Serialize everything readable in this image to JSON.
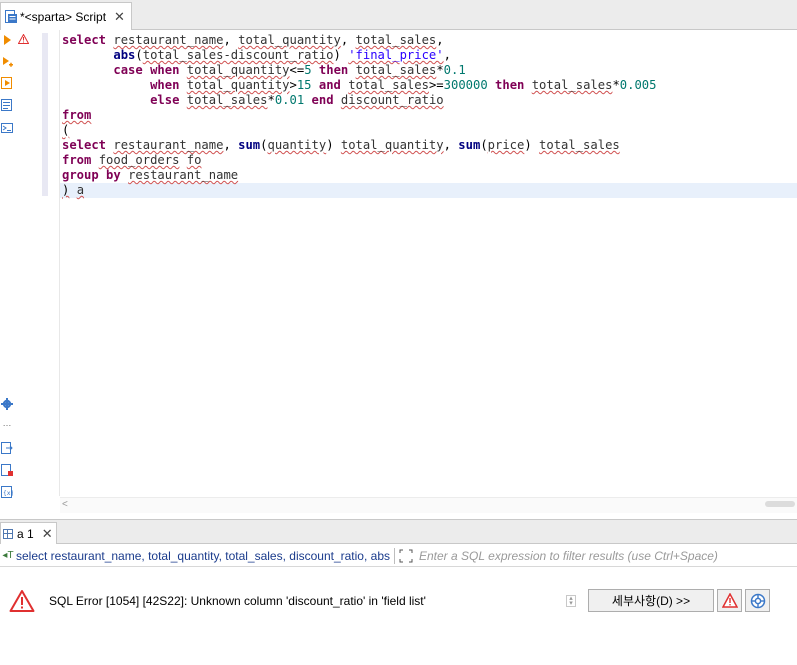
{
  "editor_tab": {
    "label": "*<sparta> Script",
    "close": "✕"
  },
  "code_lines": [
    [
      {
        "t": "select",
        "c": "kw"
      },
      {
        "t": " "
      },
      {
        "t": "restaurant_name",
        "c": "id sq"
      },
      {
        "t": ", "
      },
      {
        "t": "total_quantity",
        "c": "id sq"
      },
      {
        "t": ", "
      },
      {
        "t": "total_sales",
        "c": "id sq"
      },
      {
        "t": ","
      }
    ],
    [
      {
        "t": "       "
      },
      {
        "t": "abs",
        "c": "fn"
      },
      {
        "t": "("
      },
      {
        "t": "total_sales-discount_ratio",
        "c": "id sq"
      },
      {
        "t": ") "
      },
      {
        "t": "'final_price'",
        "c": "str sq"
      },
      {
        "t": ","
      }
    ],
    [
      {
        "t": "       "
      },
      {
        "t": "case",
        "c": "kw"
      },
      {
        "t": " "
      },
      {
        "t": "when",
        "c": "kw"
      },
      {
        "t": " "
      },
      {
        "t": "total_quantity",
        "c": "id sq"
      },
      {
        "t": "<="
      },
      {
        "t": "5",
        "c": "num"
      },
      {
        "t": " "
      },
      {
        "t": "then",
        "c": "kw"
      },
      {
        "t": " "
      },
      {
        "t": "total_sales",
        "c": "id sq"
      },
      {
        "t": "*"
      },
      {
        "t": "0.1",
        "c": "num"
      }
    ],
    [
      {
        "t": "            "
      },
      {
        "t": "when",
        "c": "kw"
      },
      {
        "t": " "
      },
      {
        "t": "total_quantity",
        "c": "id sq"
      },
      {
        "t": ">"
      },
      {
        "t": "15",
        "c": "num"
      },
      {
        "t": " "
      },
      {
        "t": "and",
        "c": "kw"
      },
      {
        "t": " "
      },
      {
        "t": "total_sales",
        "c": "id sq"
      },
      {
        "t": ">="
      },
      {
        "t": "300000",
        "c": "num"
      },
      {
        "t": " "
      },
      {
        "t": "then",
        "c": "kw"
      },
      {
        "t": " "
      },
      {
        "t": "total_sales",
        "c": "id sq"
      },
      {
        "t": "*"
      },
      {
        "t": "0.005",
        "c": "num"
      }
    ],
    [
      {
        "t": "            "
      },
      {
        "t": "else",
        "c": "kw"
      },
      {
        "t": " "
      },
      {
        "t": "total_sales",
        "c": "id sq"
      },
      {
        "t": "*"
      },
      {
        "t": "0.01",
        "c": "num"
      },
      {
        "t": " "
      },
      {
        "t": "end",
        "c": "kw"
      },
      {
        "t": " "
      },
      {
        "t": "discount_ratio",
        "c": "id sq"
      }
    ],
    [
      {
        "t": "from",
        "c": "kw sq"
      }
    ],
    [
      {
        "t": "(",
        "c": "sq"
      }
    ],
    [
      {
        "t": "select",
        "c": "kw"
      },
      {
        "t": " "
      },
      {
        "t": "restaurant_name",
        "c": "id sq"
      },
      {
        "t": ", "
      },
      {
        "t": "sum",
        "c": "fn"
      },
      {
        "t": "("
      },
      {
        "t": "quantity",
        "c": "id sq"
      },
      {
        "t": ") "
      },
      {
        "t": "total_quantity",
        "c": "id sq"
      },
      {
        "t": ", "
      },
      {
        "t": "sum",
        "c": "fn"
      },
      {
        "t": "("
      },
      {
        "t": "price",
        "c": "id sq"
      },
      {
        "t": ") "
      },
      {
        "t": "total_sales",
        "c": "id sq"
      }
    ],
    [
      {
        "t": "from",
        "c": "kw"
      },
      {
        "t": " "
      },
      {
        "t": "food_orders",
        "c": "id sq"
      },
      {
        "t": " "
      },
      {
        "t": "fo",
        "c": "id sq"
      }
    ],
    [
      {
        "t": "group",
        "c": "kw"
      },
      {
        "t": " "
      },
      {
        "t": "by",
        "c": "kw"
      },
      {
        "t": " "
      },
      {
        "t": "restaurant_name",
        "c": "id sq"
      }
    ],
    [
      {
        "t": ")",
        "c": "sq"
      },
      {
        "t": " "
      },
      {
        "t": "a",
        "c": "id sq"
      }
    ]
  ],
  "result_tab": {
    "label": "a 1",
    "close": "✕"
  },
  "filter": {
    "query": "select restaurant_name, total_quantity, total_sales, discount_ratio, abs",
    "placeholder": "Enter a SQL expression to filter results (use Ctrl+Space)"
  },
  "error": {
    "message": "SQL Error [1054] [42S22]: Unknown column 'discount_ratio' in 'field list'",
    "details_button": "세부사항(D) >>"
  },
  "colors": {
    "keyword": "#7f0055",
    "string": "#2a00ff",
    "number": "#00786e",
    "error": "#e03030",
    "accent": "#3b78c8"
  }
}
